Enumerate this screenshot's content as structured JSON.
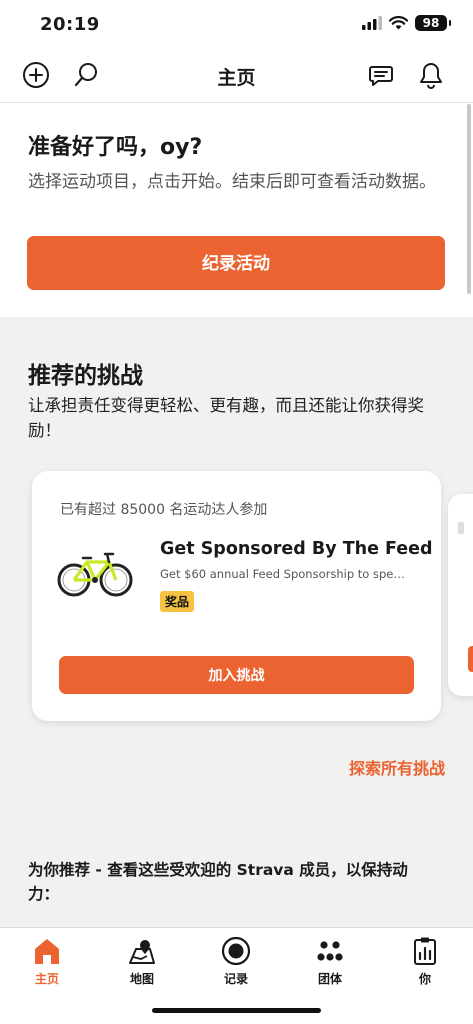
{
  "status_bar": {
    "time": "20:19",
    "battery": "98"
  },
  "header": {
    "title": "主页"
  },
  "ready": {
    "title": "准备好了吗，oy?",
    "description": "选择运动项目，点击开始。结束后即可查看活动数据。",
    "record_button": "纪录活动"
  },
  "challenges": {
    "title": "推荐的挑战",
    "subtitle": "让承担责任变得更轻松、更有趣，而且还能让你获得奖励！",
    "card": {
      "participants": "已有超过 85000 名运动达人参加",
      "name": "Get Sponsored By The Feed",
      "description": "Get $60 annual Feed Sponsorship to spen...",
      "badge": "奖品",
      "join_button": "加入挑战"
    },
    "explore_link": "探索所有挑战"
  },
  "recommend": {
    "title": "为你推荐 - 查看这些受欢迎的 Strava 成员，以保持动力："
  },
  "tabs": [
    {
      "label": "主页",
      "icon": "home-icon",
      "active": true
    },
    {
      "label": "地图",
      "icon": "map-icon",
      "active": false
    },
    {
      "label": "记录",
      "icon": "record-icon",
      "active": false
    },
    {
      "label": "团体",
      "icon": "groups-icon",
      "active": false
    },
    {
      "label": "你",
      "icon": "profile-icon",
      "active": false
    }
  ],
  "colors": {
    "accent": "#eb6330",
    "badge": "#f5c242",
    "background": "#f1f1f0"
  }
}
